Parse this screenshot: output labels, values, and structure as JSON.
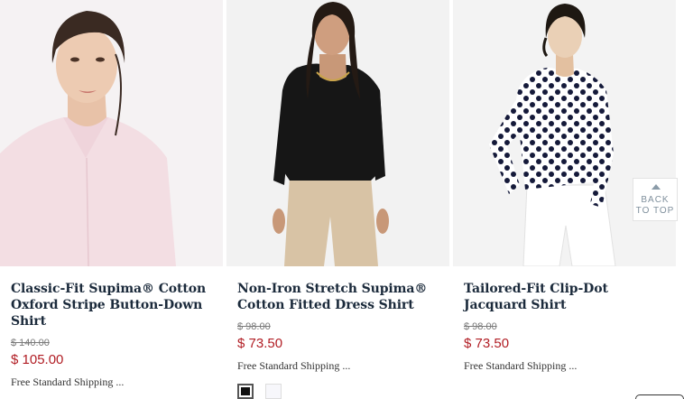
{
  "products": [
    {
      "title": "Classic-Fit Supima® Cotton Oxford Stripe Button-Down Shirt",
      "old_price": "$ 140.00",
      "price": "$ 105.00",
      "shipping": "Free Standard Shipping ...",
      "image_bg": "#f4f1f2",
      "shirt_color": "#f4dfe4",
      "image_icon": "model-pink-shirt-photo"
    },
    {
      "title": "Non-Iron Stretch Supima® Cotton Fitted Dress Shirt",
      "old_price": "$ 98.00",
      "price": "$ 73.50",
      "shipping": "Free Standard Shipping ...",
      "image_bg": "#f2f2f2",
      "shirt_color": "#151515",
      "image_icon": "model-black-shirt-photo"
    },
    {
      "title": "Tailored-Fit Clip-Dot Jacquard Shirt",
      "old_price": "$ 98.00",
      "price": "$ 73.50",
      "shipping": "Free Standard Shipping ...",
      "image_bg": "#f3f3f3",
      "shirt_color": "#ffffff",
      "image_icon": "model-polka-dot-shirt-photo"
    }
  ],
  "swatches": [
    {
      "name": "Black",
      "color": "#111111",
      "selected": true
    },
    {
      "name": "White",
      "color": "#f7f7fb",
      "selected": false
    }
  ],
  "back_to_top": {
    "label": "BACK TO TOP",
    "icon": "chevron-up-icon"
  },
  "colors": {
    "title": "#1b2a3b",
    "sale_price": "#b11d24",
    "old_price": "#7a7a7a"
  }
}
